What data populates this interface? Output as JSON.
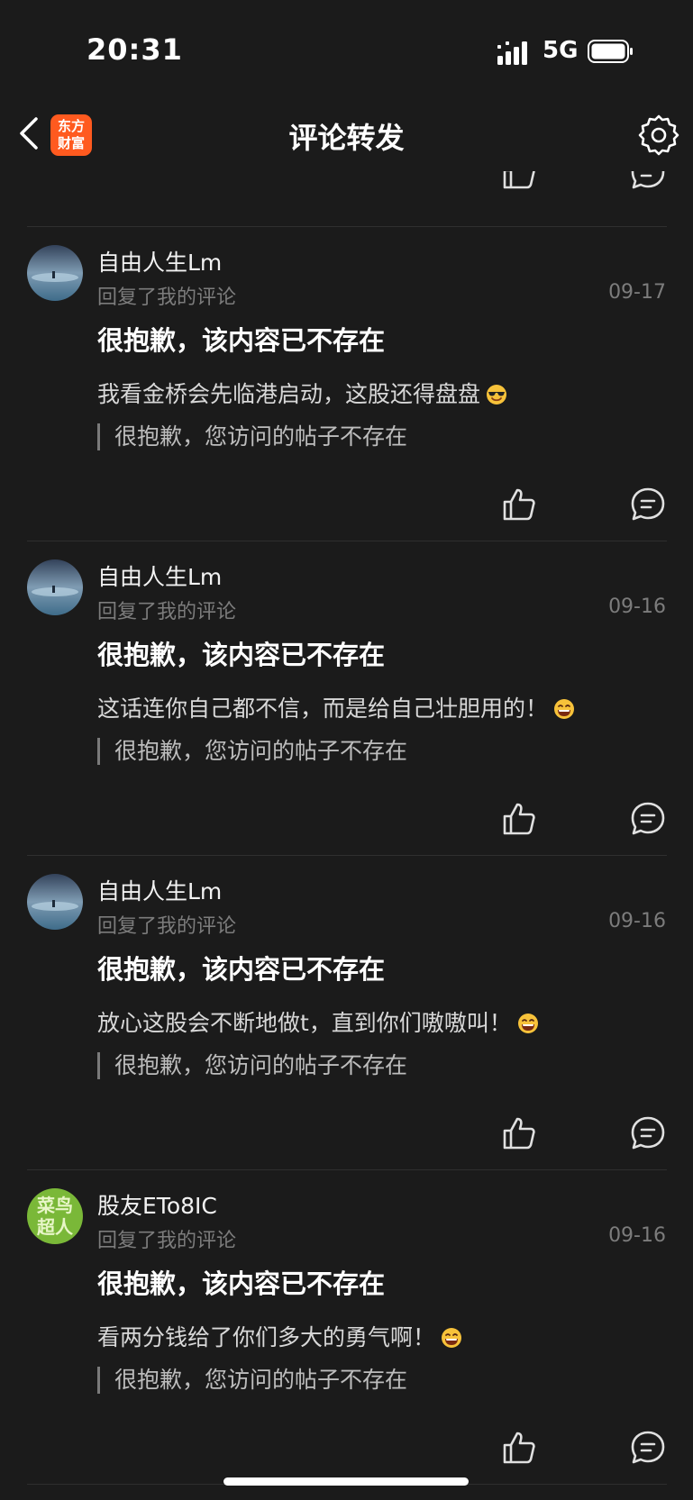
{
  "status_bar": {
    "time": "20:31",
    "network": "5G"
  },
  "nav": {
    "title": "评论转发",
    "logo_line1": "东方",
    "logo_line2": "财富"
  },
  "comments": [
    {
      "user": "自由人生Lm",
      "subtitle": "回复了我的评论",
      "date": "09-17",
      "headline": "很抱歉，该内容已不存在",
      "body": "我看金桥会先临港启动，这股还得盘盘",
      "emoji": "sunglasses-emoji",
      "quote": "很抱歉，您访问的帖子不存在",
      "avatar": "sky-avatar"
    },
    {
      "user": "自由人生Lm",
      "subtitle": "回复了我的评论",
      "date": "09-16",
      "headline": "很抱歉，该内容已不存在",
      "body": "这话连你自己都不信，而是给自己壮胆用的！",
      "emoji": "laughing-emoji",
      "quote": "很抱歉，您访问的帖子不存在",
      "avatar": "sky-avatar"
    },
    {
      "user": "自由人生Lm",
      "subtitle": "回复了我的评论",
      "date": "09-16",
      "headline": "很抱歉，该内容已不存在",
      "body": "放心这股会不断地做t，直到你们嗷嗷叫！",
      "emoji": "laughing-emoji",
      "quote": "很抱歉，您访问的帖子不存在",
      "avatar": "sky-avatar"
    },
    {
      "user": "股友ETo8IC",
      "subtitle": "回复了我的评论",
      "date": "09-16",
      "headline": "很抱歉，该内容已不存在",
      "body": "看两分钱给了你们多大的勇气啊！",
      "emoji": "laughing-emoji",
      "quote": "很抱歉，您访问的帖子不存在",
      "avatar": "green-badge-avatar",
      "avatar_text": "菜鸟超人"
    }
  ],
  "colors": {
    "background": "#1b1b1b",
    "brand": "#ff5a1f",
    "muted": "#7c7c7c"
  }
}
